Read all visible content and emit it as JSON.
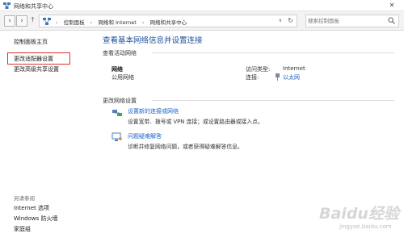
{
  "window": {
    "title": "网络和共享中心",
    "close_glyph": "✕"
  },
  "nav": {
    "back_glyph": "‹",
    "forward_glyph": "›",
    "up_glyph": "↑",
    "breadcrumbs": [
      "控制面板",
      "网络和 Internet",
      "网络和共享中心"
    ],
    "dropdown_glyph": "∨",
    "refresh_glyph": "↻",
    "search_placeholder": "搜索控制面板"
  },
  "sidebar": {
    "links": [
      "控制面板主页",
      "更改适配器设置",
      "更改高级共享设置"
    ],
    "see_also_title": "另请参阅",
    "see_also_links": [
      "Internet 选项",
      "Windows 防火墙",
      "家庭组"
    ]
  },
  "main": {
    "title": "查看基本网络信息并设置连接",
    "active_section": "查看活动网络",
    "network": {
      "name": "网络",
      "type": "公用网络",
      "access_label": "访问类型:",
      "access_value": "Internet",
      "connection_label": "连接:",
      "connection_value": "以太网"
    },
    "change_section": "更改网络设置",
    "tasks": [
      {
        "link": "设置新的连接或网络",
        "desc": "设置宽带、拨号或 VPN 连接；或设置路由器或接入点。"
      },
      {
        "link": "问题疑难解答",
        "desc": "诊断并修复网络问题，或者获得疑难解答信息。"
      }
    ]
  },
  "watermark": {
    "logo": "Baidu经验",
    "url": "jingyan.baidu.com"
  },
  "colors": {
    "link": "#1a63c8",
    "title": "#1a4f9c",
    "highlight": "#d93030"
  }
}
